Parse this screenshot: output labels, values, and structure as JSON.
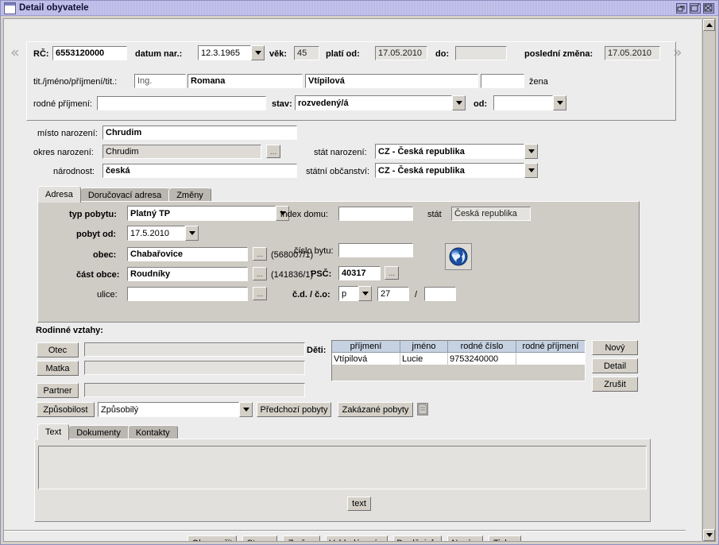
{
  "window": {
    "title": "Detail obyvatele",
    "controls": {
      "restore": "restore-button",
      "maximize": "maximize-button",
      "close": "close-button"
    }
  },
  "nav": {
    "prev": "«",
    "next": "»"
  },
  "header": {
    "rc_label": "RČ:",
    "rc_value": "6553120000",
    "birth_label": "datum nar.:",
    "birth_value": "12.3.1965",
    "age_label": "věk:",
    "age_value": "45",
    "valid_from_label": "platí od:",
    "valid_from_value": "17.05.2010",
    "valid_to_label": "do:",
    "valid_to_value": "",
    "last_change_label": "poslední změna:",
    "last_change_value": "17.05.2010"
  },
  "identity": {
    "name_label": "tit./jméno/příjmení/tit.:",
    "title_before": "Ing.",
    "first_name": "Romana",
    "last_name": "Vtípilová",
    "title_after": "",
    "sex": "žena",
    "maiden_label": "rodné příjmení:",
    "maiden_value": "",
    "status_label": "stav:",
    "status_value": "rozvedený/á",
    "status_from_label": "od:",
    "status_from_value": ""
  },
  "birth": {
    "place_label": "místo narození:",
    "place_value": "Chrudim",
    "district_label": "okres narození:",
    "district_value": "Chrudim",
    "nationality_label": "národnost:",
    "nationality_value": "česká",
    "state_label": "stát narození:",
    "state_value": "CZ - Česká republika",
    "citizenship_label": "státní občanství:",
    "citizenship_value": "CZ - Česká republika",
    "browse_button": "..."
  },
  "address_tabs": [
    {
      "label": "Adresa",
      "active": true
    },
    {
      "label": "Doručovací adresa",
      "active": false
    },
    {
      "label": "Změny",
      "active": false
    }
  ],
  "address": {
    "type_label": "typ pobytu:",
    "type_value": "Platný TP",
    "since_label": "pobyt od:",
    "since_value": "17.5.2010",
    "municipality_label": "obec:",
    "municipality_value": "Chabařovice",
    "municipality_code": "(568007/1)",
    "part_label": "část obce:",
    "part_value": "Roudníky",
    "part_code": "(141836/1)",
    "street_label": "ulice:",
    "street_value": "",
    "house_index_label": "index domu:",
    "house_index_value": "",
    "flat_label": "číslo bytu:",
    "flat_value": "",
    "zip_label": "PSČ:",
    "zip_value": "40317",
    "cdco_label": "č.d. / č.o:",
    "cdco_type": "p",
    "cdco_num": "27",
    "cdco_slash": "/",
    "cdco_num2": "",
    "state_label": "stát",
    "state_value": "Česká republika",
    "browse_button": "...",
    "globe_icon": "globe-icon"
  },
  "relations": {
    "title": "Rodinné vztahy:",
    "father_button": "Otec",
    "father_value": "",
    "mother_button": "Matka",
    "mother_value": "",
    "partner_button": "Partner",
    "partner_value": "",
    "capacity_button": "Způsobilost",
    "capacity_value": "Způsobilý",
    "previous_stays_button": "Předchozí pobyty",
    "forbidden_stays_button": "Zakázané pobyty",
    "note_icon": "note-icon"
  },
  "children": {
    "label": "Děti:",
    "columns": [
      "příjmení",
      "jméno",
      "rodné číslo",
      "rodné příjmení"
    ],
    "rows": [
      [
        "Vtípilová",
        "Lucie",
        "9753240000",
        ""
      ]
    ],
    "buttons": [
      "Nový",
      "Detail",
      "Zrušit"
    ]
  },
  "bottom_tabs": [
    {
      "label": "Text",
      "active": true
    },
    {
      "label": "Dokumenty",
      "active": false
    },
    {
      "label": "Kontakty",
      "active": false
    }
  ],
  "bottom_panel": {
    "text_value": "",
    "text_button": "text"
  },
  "footer": {
    "buttons": [
      "Ok-uzavřít",
      "Storno",
      "Změny",
      "Vyhledávaní...",
      "Doplň. info",
      "Nový...",
      "Tisk..."
    ]
  }
}
